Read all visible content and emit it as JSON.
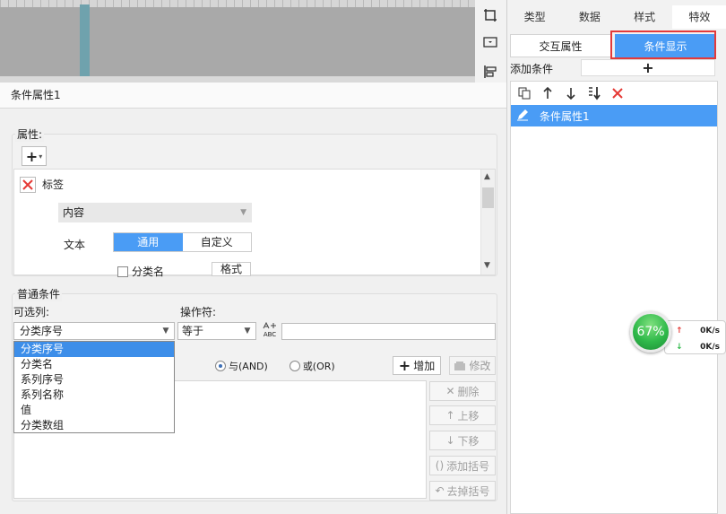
{
  "canvas": {},
  "tool_column": {
    "icons": [
      "crop-icon",
      "dropdown-box-icon",
      "align-icon"
    ]
  },
  "right_panel": {
    "tabs": [
      "类型",
      "数据",
      "样式",
      "特效"
    ],
    "active_tab": "特效",
    "sub_tabs": [
      "交互属性",
      "条件显示"
    ],
    "active_sub_tab": "条件显示",
    "add_condition_label": "添加条件",
    "add_condition_button": "+",
    "list_items": [
      {
        "label": "条件属性1",
        "selected": true
      }
    ]
  },
  "net_widget": {
    "percent": "67%",
    "upload": "0K/s",
    "download": "0K/s"
  },
  "editor": {
    "title": "条件属性1",
    "attributes_legend": "属性:",
    "add_attr": "+",
    "tag_label": "标签",
    "content_select": "内容",
    "text_label": "文本",
    "segment": [
      "通用",
      "自定义"
    ],
    "active_segment": "通用",
    "category_checkbox": "分类名",
    "format_button": "格式",
    "general_legend": "普通条件",
    "column_label": "可选列:",
    "operator_label": "操作符:",
    "column_value": "分类序号",
    "operator_value": "等于",
    "abc_text": "ABC",
    "column_options": [
      "分类序号",
      "分类名",
      "系列序号",
      "系列名称",
      "值",
      "分类数组"
    ],
    "selected_option_index": 0,
    "logic_and": "与(AND)",
    "logic_or": "或(OR)",
    "add_button": "增加",
    "modify_button": "修改",
    "side_buttons": [
      {
        "name": "delete-button",
        "icon": "x-icon",
        "label": "删除",
        "glyph": "✕"
      },
      {
        "name": "move-up-button",
        "icon": "arrow-up-icon",
        "label": "上移",
        "glyph": "↑"
      },
      {
        "name": "move-down-button",
        "icon": "arrow-down-icon",
        "label": "下移",
        "glyph": "↓"
      },
      {
        "name": "add-brackets-button",
        "icon": "brackets-icon",
        "label": "添加括号",
        "glyph": "()"
      },
      {
        "name": "remove-brackets-button",
        "icon": "remove-brackets-icon",
        "label": "去掉括号",
        "glyph": "↶"
      }
    ]
  },
  "colors": {
    "accent": "#4a9cf5",
    "highlight_border": "#e33a3a",
    "delete_red": "#e53935",
    "net_green": "#2fb94a"
  }
}
